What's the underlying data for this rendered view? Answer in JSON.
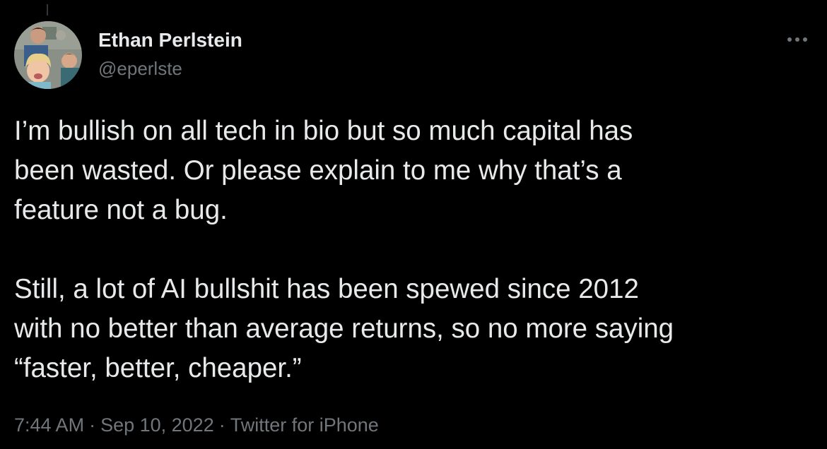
{
  "author": {
    "display_name": "Ethan Perlstein",
    "handle": "@eperlste",
    "avatar_icon": "profile-photo"
  },
  "tweet": {
    "text": "I’m bullish on all tech in bio but so much capital has\nbeen wasted. Or please explain to me why that’s a\nfeature not a bug.\n\nStill, a lot of AI bullshit has been spewed since 2012\nwith no better than average returns, so no more saying\n“faster, better, cheaper.”"
  },
  "meta": {
    "time": "7:44 AM",
    "date": "Sep 10, 2022",
    "source": "Twitter for iPhone",
    "separator": "·"
  },
  "icons": {
    "more": "more-horizontal-icon"
  },
  "colors": {
    "background": "#000000",
    "primary_text": "#e7e9ea",
    "secondary_text": "#71767b"
  }
}
